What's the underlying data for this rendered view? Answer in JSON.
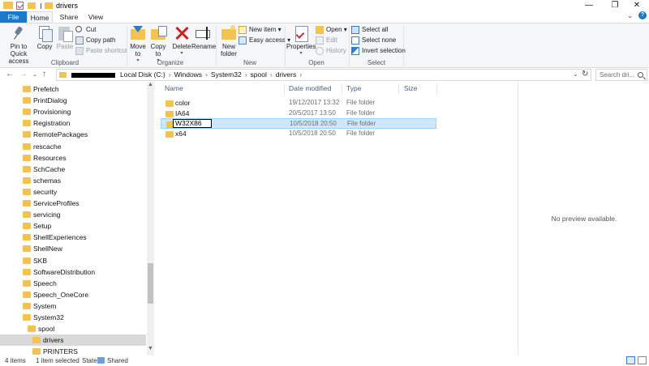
{
  "window": {
    "title": "drivers",
    "controls": {
      "minimize": "—",
      "maximize": "❐",
      "close": "✕"
    }
  },
  "ribbon_tabs": [
    {
      "label": "File"
    },
    {
      "label": "Home"
    },
    {
      "label": "Share"
    },
    {
      "label": "View"
    }
  ],
  "ribbon": {
    "clipboard": {
      "pin_label": "Pin to Quick access",
      "copy_label": "Copy",
      "paste_label": "Paste",
      "cut_label": "Cut",
      "copy_path_label": "Copy path",
      "paste_shortcut_label": "Paste shortcut",
      "group_label": "Clipboard"
    },
    "organize": {
      "move_to_label": "Move to",
      "copy_to_label": "Copy to",
      "delete_label": "Delete",
      "rename_label": "Rename",
      "group_label": "Organize"
    },
    "new": {
      "new_folder_label": "New folder",
      "new_item_label": "New item",
      "easy_access_label": "Easy access",
      "group_label": "New"
    },
    "open": {
      "properties_label": "Properties",
      "open_label": "Open",
      "edit_label": "Edit",
      "history_label": "History",
      "group_label": "Open"
    },
    "select": {
      "select_all_label": "Select all",
      "select_none_label": "Select none",
      "invert_label": "Invert selection",
      "group_label": "Select"
    }
  },
  "address": {
    "crumbs": [
      "Local Disk (C:)",
      "Windows",
      "System32",
      "spool",
      "drivers"
    ],
    "search_placeholder": "Search dri..."
  },
  "nav_tree": [
    {
      "label": "Prefetch",
      "indent": 0
    },
    {
      "label": "PrintDialog",
      "indent": 0
    },
    {
      "label": "Provisioning",
      "indent": 0
    },
    {
      "label": "Registration",
      "indent": 0
    },
    {
      "label": "RemotePackages",
      "indent": 0
    },
    {
      "label": "rescache",
      "indent": 0
    },
    {
      "label": "Resources",
      "indent": 0
    },
    {
      "label": "SchCache",
      "indent": 0
    },
    {
      "label": "schemas",
      "indent": 0
    },
    {
      "label": "security",
      "indent": 0
    },
    {
      "label": "ServiceProfiles",
      "indent": 0
    },
    {
      "label": "servicing",
      "indent": 0
    },
    {
      "label": "Setup",
      "indent": 0
    },
    {
      "label": "ShellExperiences",
      "indent": 0
    },
    {
      "label": "ShellNew",
      "indent": 0
    },
    {
      "label": "SKB",
      "indent": 0
    },
    {
      "label": "SoftwareDistribution",
      "indent": 0
    },
    {
      "label": "Speech",
      "indent": 0
    },
    {
      "label": "Speech_OneCore",
      "indent": 0
    },
    {
      "label": "System",
      "indent": 0
    },
    {
      "label": "System32",
      "indent": 0
    },
    {
      "label": "spool",
      "indent": 1
    },
    {
      "label": "drivers",
      "indent": 2,
      "selected": true
    },
    {
      "label": "PRINTERS",
      "indent": 2
    }
  ],
  "columns": {
    "name": "Name",
    "date": "Date modified",
    "type": "Type",
    "size": "Size"
  },
  "files": [
    {
      "name": "color",
      "date": "19/12/2017 13:32",
      "type": "File folder"
    },
    {
      "name": "IA64",
      "date": "20/5/2017 13:50",
      "type": "File folder"
    },
    {
      "name": "W32X86",
      "date": "10/5/2018 20:50",
      "type": "File folder",
      "selected": true,
      "renaming": true
    },
    {
      "name": "x64",
      "date": "10/5/2018 20:50",
      "type": "File folder"
    }
  ],
  "preview": {
    "message": "No preview available."
  },
  "status": {
    "items": "4 items",
    "selected": "1 item selected",
    "state_label": "State:",
    "state_value": "Shared"
  },
  "colors": {
    "accent": "#1979ca",
    "selection": "#cce8ff",
    "folder": "#f2c350"
  }
}
